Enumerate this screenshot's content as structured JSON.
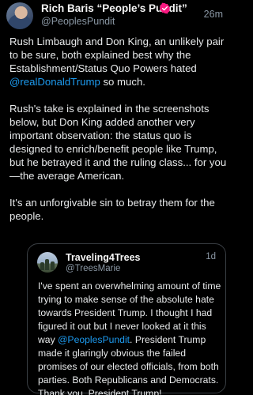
{
  "tweet": {
    "author_name": "Rich Baris “People’s Pundit”",
    "handle": "@PeoplesPundit",
    "time": "26m",
    "verified_icon": "verified-badge-icon",
    "p1_text_a": "Rush Limbaugh and Don King, an unlikely pair to be sure, both explained best why the Establishment/Status Quo Powers hated ",
    "p1_mention": "@realDonaldTrump",
    "p1_text_b": " so much.",
    "p2_text": "Rush's take is explained in the screenshots below, but Don King added another very important observation: the status quo is designed to enrich/benefit people like Trump, but he betrayed it and the ruling class... for you—the average American.",
    "p3_text": "It's an unforgivable sin to betray them for the people."
  },
  "quoted_tweet": {
    "author_name": "Traveling4Trees",
    "handle": "@TreesMarie",
    "time": "1d",
    "text_a": "I've spent an overwhelming amount of time trying to make sense of the absolute hate towards President Trump. I thought I had figured it out but I never looked at it this way ",
    "mention": "@PeoplesPundit",
    "text_b": ". President Trump made it glaringly obvious the failed promises of our elected officials, from both parties. Both Republicans and Democrats. Thank you, President Trump!"
  },
  "colors": {
    "background": "#000000",
    "text": "#e7e9ea",
    "secondary": "#8b98a5",
    "link": "#1d9bf0",
    "verified_badge": "#f91880"
  }
}
